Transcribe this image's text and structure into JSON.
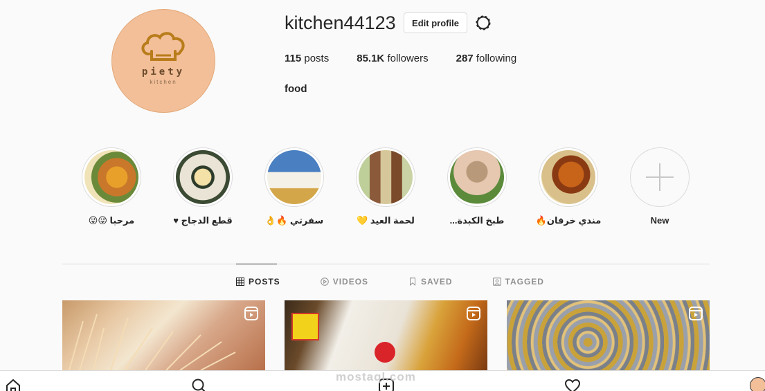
{
  "profile": {
    "username": "kitchen44123",
    "edit_label": "Edit profile",
    "brand_name": "piety",
    "brand_sub": "kitchen",
    "bio": "food"
  },
  "stats": [
    {
      "count": "115",
      "label": "posts"
    },
    {
      "count": "85.1K",
      "label": "followers"
    },
    {
      "count": "287",
      "label": "following"
    }
  ],
  "highlights": [
    {
      "label": "مرحبا 😜😜"
    },
    {
      "label": "قطع الدجاج ♥"
    },
    {
      "label": "سفرتي 🔥👌"
    },
    {
      "label": "لحمة العيد 💛"
    },
    {
      "label": "طبخ الكبدة..."
    },
    {
      "label": "مندي خرفان🔥"
    },
    {
      "label": "New"
    }
  ],
  "tabs": [
    {
      "label": "POSTS",
      "icon": "grid-icon"
    },
    {
      "label": "VIDEOS",
      "icon": "play-circle-icon"
    },
    {
      "label": "SAVED",
      "icon": "bookmark-icon"
    },
    {
      "label": "TAGGED",
      "icon": "tag-icon"
    }
  ],
  "watermark": "mostaql.com",
  "colors": {
    "avatar_bg": "#f2bf99",
    "brand": "#b87c1a",
    "border": "#dbdbdb",
    "text": "#262626",
    "muted": "#8e8e8e"
  }
}
